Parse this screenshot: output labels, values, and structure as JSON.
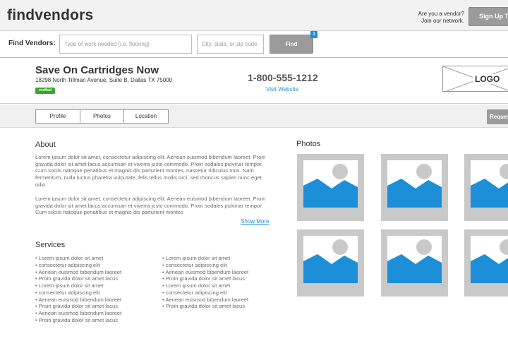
{
  "header": {
    "brand": "findvendors",
    "vendor_prompt_line1": "Are you a vendor?",
    "vendor_prompt_line2": "Join our network.",
    "signup_label": "Sign Up Today"
  },
  "search": {
    "label": "Find Vendors:",
    "work_placeholder": "Type of work needed (i.e. flooring)",
    "location_placeholder": "City, state, or zip code",
    "button_label": "Find",
    "badge": "1"
  },
  "business": {
    "name": "Save On Cartridges Now",
    "address": "18298 North Tillman Avenue, Suite B, Dallas TX 75000",
    "verified_label": "verified",
    "phone": "1-800-555-1212",
    "website_label": "Visit Website",
    "logo_label": "LOGO"
  },
  "tabs": [
    "Profile",
    "Photos",
    "Location"
  ],
  "request_label": "Request a Quote",
  "about": {
    "title": "About",
    "paragraph1": "Lorem ipsum dolor sit amet, consectetur adipiscing elit. Aenean euismod bibendum laoreet. Proin gravida dolor sit amet lacus accumsan et viverra justo commodo. Proin sodales pulvinar tempor. Cum sociis natoque penatibus et magnis dis parturient montes, nascetur ridiculus mus. Nam fermentum, nulla luctus pharetra vulputate, felis tellus mollis orci, sed rhoncus sapien nunc eget odio.",
    "paragraph2": "Lorem ipsum dolor sit amet, consectetur adipiscing elit. Aenean euismod bibendum laoreet. Proin gravida dolor sit amet lacus accumsan et viverra justo commodo. Proin sodales pulvinar tempor. Cum sociis natoque penatibus et magnis dis parturient montes",
    "show_more": "Show More"
  },
  "services": {
    "title": "Services",
    "left": [
      "Lorem ipsum dolor sit amet",
      "consectetur adipiscing elit",
      "Aenean euismod bibendum laoreet",
      "Proin gravida dolor sit amet lacus",
      "Lorem ipsum dolor sit amet",
      "consectetur adipiscing elit",
      "Aenean euismod bibendum laoreet",
      "Proin gravida dolor sit amet lacus",
      "Aenean euismod bibendum laoreet",
      "Proin gravida dolor sit amet lacus"
    ],
    "right": [
      "Lorem ipsum dolor sit amet",
      "consectetur adipiscing elit",
      "Aenean euismod bibendum laoreet",
      "Proin gravida dolor sit amet lacus",
      "Lorem ipsum dolor sit amet",
      "consectetur adipiscing elit",
      "Aenean euismod bibendum laoreet",
      "Proin gravida dolor sit amet lacus"
    ]
  },
  "photos": {
    "title": "Photos",
    "placeholder_icon": "image-placeholder-icon"
  },
  "colors": {
    "accent": "#1d8fd8",
    "verified": "#3aa52f",
    "button": "#9b9b9b"
  }
}
